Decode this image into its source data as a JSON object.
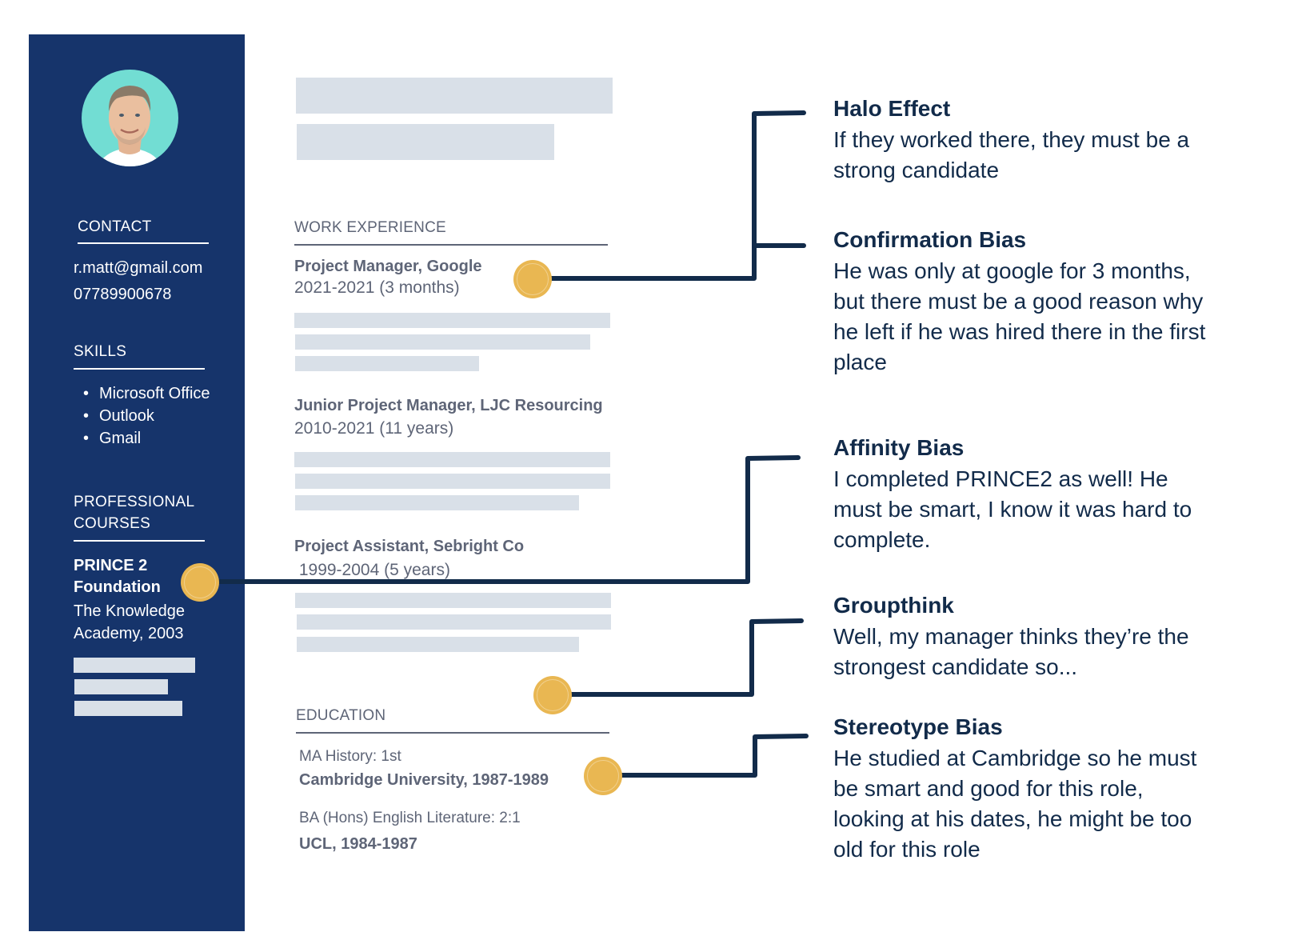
{
  "sidebar": {
    "avatar_alt": "candidate-photo",
    "contact": {
      "heading": "CONTACT",
      "email": "r.matt@gmail.com",
      "phone": "07789900678"
    },
    "skills": {
      "heading": "SKILLS",
      "items": [
        "Microsoft Office",
        "Outlook",
        "Gmail"
      ]
    },
    "courses": {
      "heading_line1": "PROFESSIONAL",
      "heading_line2": "COURSES",
      "course_name_line1": "PRINCE 2",
      "course_name_line2": "Foundation",
      "provider_line1": "The Knowledge",
      "provider_line2": "Academy, 2003"
    }
  },
  "main": {
    "work_experience": {
      "heading": "WORK EXPERIENCE",
      "jobs": [
        {
          "title": "Project Manager, Google",
          "dates": "2021-2021 (3 months)"
        },
        {
          "title": "Junior Project Manager, LJC Resourcing",
          "dates": "2010-2021 (11 years)"
        },
        {
          "title": "Project Assistant, Sebright Co",
          "dates": " 1999-2004 (5 years)"
        }
      ]
    },
    "education": {
      "heading": "EDUCATION",
      "entries": [
        {
          "degree": "MA History: 1st",
          "institution": "Cambridge University, 1987-1989"
        },
        {
          "degree": "BA (Hons) English Literature: 2:1",
          "institution": "UCL, 1984-1987"
        }
      ]
    }
  },
  "biases": [
    {
      "title": "Halo Effect",
      "lines": [
        "If they worked there, they must be a",
        "strong candidate"
      ]
    },
    {
      "title": "Confirmation Bias",
      "lines": [
        "He was only at google for 3 months,",
        "but there must be a good reason why",
        "he left if he was hired there in the first",
        "place"
      ]
    },
    {
      "title": "Affinity Bias",
      "lines": [
        "I completed PRINCE2 as well! He",
        "must be smart, I know it was hard to",
        "complete."
      ]
    },
    {
      "title": "Groupthink",
      "lines": [
        "Well, my manager thinks they’re the",
        "strongest candidate so..."
      ]
    },
    {
      "title": "Stereotype Bias",
      "lines": [
        "He studied at Cambridge so he must",
        "be smart and good for this role,",
        "looking at his dates, he might be too",
        "old for this role"
      ]
    }
  ],
  "colors": {
    "sidebar": "#16346b",
    "accent_dot": "#e9b752",
    "connector": "#122b4a",
    "placeholder": "#d9e0e8",
    "avatar_bg": "#72ddd3"
  }
}
